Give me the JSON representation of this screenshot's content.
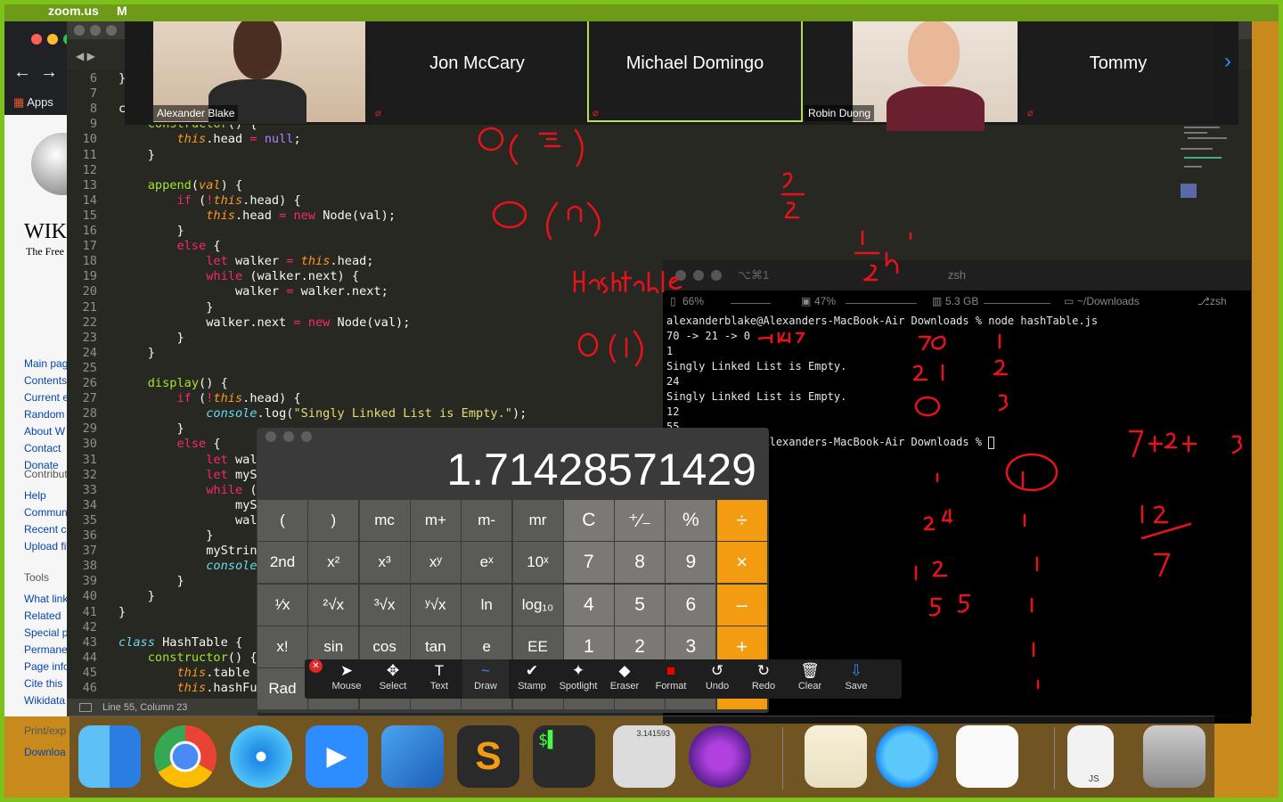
{
  "menubar": {
    "apple_glyph": "",
    "app_name": "zoom.us",
    "menu_partial": "M"
  },
  "chrome": {
    "apps_label": "Apps",
    "wiki": {
      "title": "WIK",
      "subtitle": "The Free",
      "nav_links": [
        "Main pag",
        "Contents",
        "Current e",
        "Random",
        "About W",
        "Contact",
        "Donate"
      ],
      "contribute_heading": "Contribut",
      "contribute_links": [
        "Help",
        "Commun",
        "Recent c",
        "Upload fi"
      ],
      "tools_heading": "Tools",
      "tools_links": [
        "What link",
        "Related",
        "Special p",
        "Permane",
        "Page info",
        "Cite this",
        "Wikidata"
      ],
      "print_heading": "Print/exp",
      "print_links": [
        "Downloa"
      ]
    }
  },
  "editor": {
    "status": "Line 55, Column 23",
    "lines": [
      {
        "n": "6",
        "t": "}"
      },
      {
        "n": "7",
        "t": ""
      },
      {
        "n": "8",
        "t": "c"
      },
      {
        "n": "9",
        "t": "    constructor() {"
      },
      {
        "n": "10",
        "t": "        this.head = null;"
      },
      {
        "n": "11",
        "t": "    }"
      },
      {
        "n": "12",
        "t": ""
      },
      {
        "n": "13",
        "t": "    append(val) {"
      },
      {
        "n": "14",
        "t": "        if (!this.head) {"
      },
      {
        "n": "15",
        "t": "            this.head = new Node(val);"
      },
      {
        "n": "16",
        "t": "        }"
      },
      {
        "n": "17",
        "t": "        else {"
      },
      {
        "n": "18",
        "t": "            let walker = this.head;"
      },
      {
        "n": "19",
        "t": "            while (walker.next) {"
      },
      {
        "n": "20",
        "t": "                walker = walker.next;"
      },
      {
        "n": "21",
        "t": "            }"
      },
      {
        "n": "22",
        "t": "            walker.next = new Node(val);"
      },
      {
        "n": "23",
        "t": "        }"
      },
      {
        "n": "24",
        "t": "    }"
      },
      {
        "n": "25",
        "t": ""
      },
      {
        "n": "26",
        "t": "    display() {"
      },
      {
        "n": "27",
        "t": "        if (!this.head) {"
      },
      {
        "n": "28",
        "t": "            console.log(\"Singly Linked List is Empty.\");"
      },
      {
        "n": "29",
        "t": "        }"
      },
      {
        "n": "30",
        "t": "        else {"
      },
      {
        "n": "31",
        "t": "            let wal"
      },
      {
        "n": "32",
        "t": "            let myS"
      },
      {
        "n": "33",
        "t": "            while (w"
      },
      {
        "n": "34",
        "t": "                myS"
      },
      {
        "n": "35",
        "t": "                wal"
      },
      {
        "n": "36",
        "t": "            }"
      },
      {
        "n": "37",
        "t": "            myStrin"
      },
      {
        "n": "38",
        "t": "            console"
      },
      {
        "n": "39",
        "t": "        }"
      },
      {
        "n": "40",
        "t": "    }"
      },
      {
        "n": "41",
        "t": "}"
      },
      {
        "n": "42",
        "t": ""
      },
      {
        "n": "43",
        "t": "class HashTable {"
      },
      {
        "n": "44",
        "t": "    constructor() {"
      },
      {
        "n": "45",
        "t": "        this.table ="
      },
      {
        "n": "46",
        "t": "        this.hashFu"
      }
    ]
  },
  "zoom": {
    "participants": [
      {
        "name": "Alexander Blake",
        "video": true
      },
      {
        "name": "Jon McCary",
        "video": false
      },
      {
        "name": "Michael Domingo",
        "video": false,
        "active_speaker": true
      },
      {
        "name": "Robin Duong",
        "video": true
      },
      {
        "name": "Tommy",
        "video": false
      }
    ],
    "next_glyph": "›"
  },
  "terminal": {
    "title": "zsh",
    "key_hint": "⌥⌘1",
    "battery": "66%",
    "cpu": "47%",
    "mem": "5.3 GB",
    "dir": "~/Downloads",
    "shell": "zsh",
    "lines": [
      "alexanderblake@Alexanders-MacBook-Air Downloads % node hashTable.js",
      "70 -> 21 -> 0",
      "1",
      "Singly Linked List is Empty.",
      "24",
      "Singly Linked List is Empty.",
      "12",
      "55",
      "alexanderblake@Alexanders-MacBook-Air Downloads % "
    ]
  },
  "calculator": {
    "display": "1.71428571429",
    "rows": [
      [
        "(",
        ")",
        "mc",
        "m+",
        "m-",
        "mr",
        "C",
        "⁺∕₋",
        "%",
        "÷"
      ],
      [
        "2nd",
        "x²",
        "x³",
        "xʸ",
        "eˣ",
        "10ˣ",
        "7",
        "8",
        "9",
        "×"
      ],
      [
        "¹∕x",
        "²√x",
        "³√x",
        "ʸ√x",
        "ln",
        "log₁₀",
        "4",
        "5",
        "6",
        "–"
      ],
      [
        "x!",
        "sin",
        "cos",
        "tan",
        "e",
        "EE",
        "1",
        "2",
        "3",
        "+"
      ],
      [
        "Rad",
        "",
        "",
        "",
        "",
        "",
        "",
        "",
        "",
        ""
      ]
    ]
  },
  "annotate": {
    "tools": [
      {
        "label": "Mouse",
        "icon": "mouse-icon",
        "glyph": "➤"
      },
      {
        "label": "Select",
        "icon": "select-icon",
        "glyph": "✥"
      },
      {
        "label": "Text",
        "icon": "text-icon",
        "glyph": "T"
      },
      {
        "label": "Draw",
        "icon": "draw-icon",
        "glyph": "~"
      },
      {
        "label": "Stamp",
        "icon": "stamp-icon",
        "glyph": "✔"
      },
      {
        "label": "Spotlight",
        "icon": "spotlight-icon",
        "glyph": "✦"
      },
      {
        "label": "Eraser",
        "icon": "eraser-icon",
        "glyph": "◆"
      },
      {
        "label": "Format",
        "icon": "format-icon",
        "glyph": "■"
      },
      {
        "label": "Undo",
        "icon": "undo-icon",
        "glyph": "↺"
      },
      {
        "label": "Redo",
        "icon": "redo-icon",
        "glyph": "↻"
      },
      {
        "label": "Clear",
        "icon": "clear-icon",
        "glyph": "🗑"
      },
      {
        "label": "Save",
        "icon": "save-icon",
        "glyph": "⇩"
      }
    ],
    "selected": "Draw"
  },
  "dock": {
    "apps": [
      "finder-icon",
      "chrome-icon",
      "safari-icon",
      "zoom-icon",
      "xcode-icon",
      "sublime-icon",
      "terminal-icon",
      "calculator-icon",
      "imovie-icon",
      "pages-icon",
      "messages-icon",
      "textedit-icon",
      "js-file-icon",
      "trash-icon"
    ],
    "calculator_badge": "3.141593",
    "js_label": "JS"
  },
  "colors": {
    "border": "#7cc21a",
    "ink": "#e8121c",
    "accent_orange": "#f39c12"
  }
}
